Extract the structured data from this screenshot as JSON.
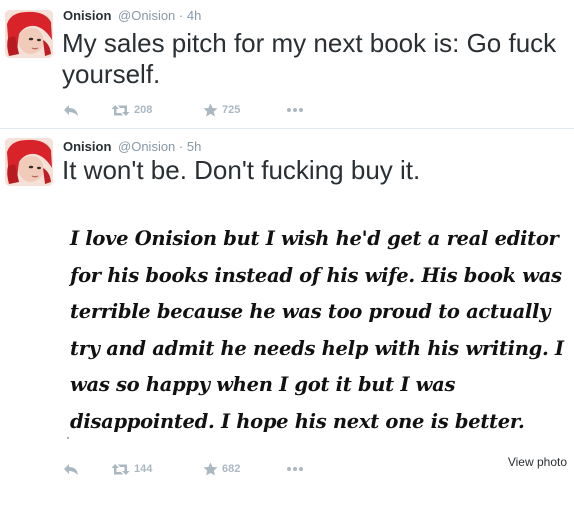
{
  "colors": {
    "text": "#292f33",
    "muted": "#8899a6",
    "action": "#aab8c2",
    "divider": "#e1e8ed",
    "avatar_hair": "#d8232a"
  },
  "tweets": [
    {
      "name": "Onision",
      "handle": "@Onision",
      "separator": "·",
      "time": "4h",
      "text": "My sales pitch for my next book is: Go fuck yourself.",
      "retweets": "208",
      "favorites": "725",
      "icons": [
        "reply-icon",
        "retweet-icon",
        "star-icon",
        "more-icon"
      ]
    },
    {
      "name": "Onision",
      "handle": "@Onision",
      "separator": "·",
      "time": "5h",
      "text": "It won't be. Don't fucking buy it.",
      "photo_text": "I love Onision but I wish he'd get a real editor for his books instead of his wife. His book was terrible because he was too proud to actually try and admit he needs help with his writing. I was so happy when I got it but I was disappointed. I hope his next one is better.",
      "view_photo_label": "View photo",
      "retweets": "144",
      "favorites": "682",
      "icons": [
        "reply-icon",
        "retweet-icon",
        "star-icon",
        "more-icon"
      ]
    }
  ]
}
